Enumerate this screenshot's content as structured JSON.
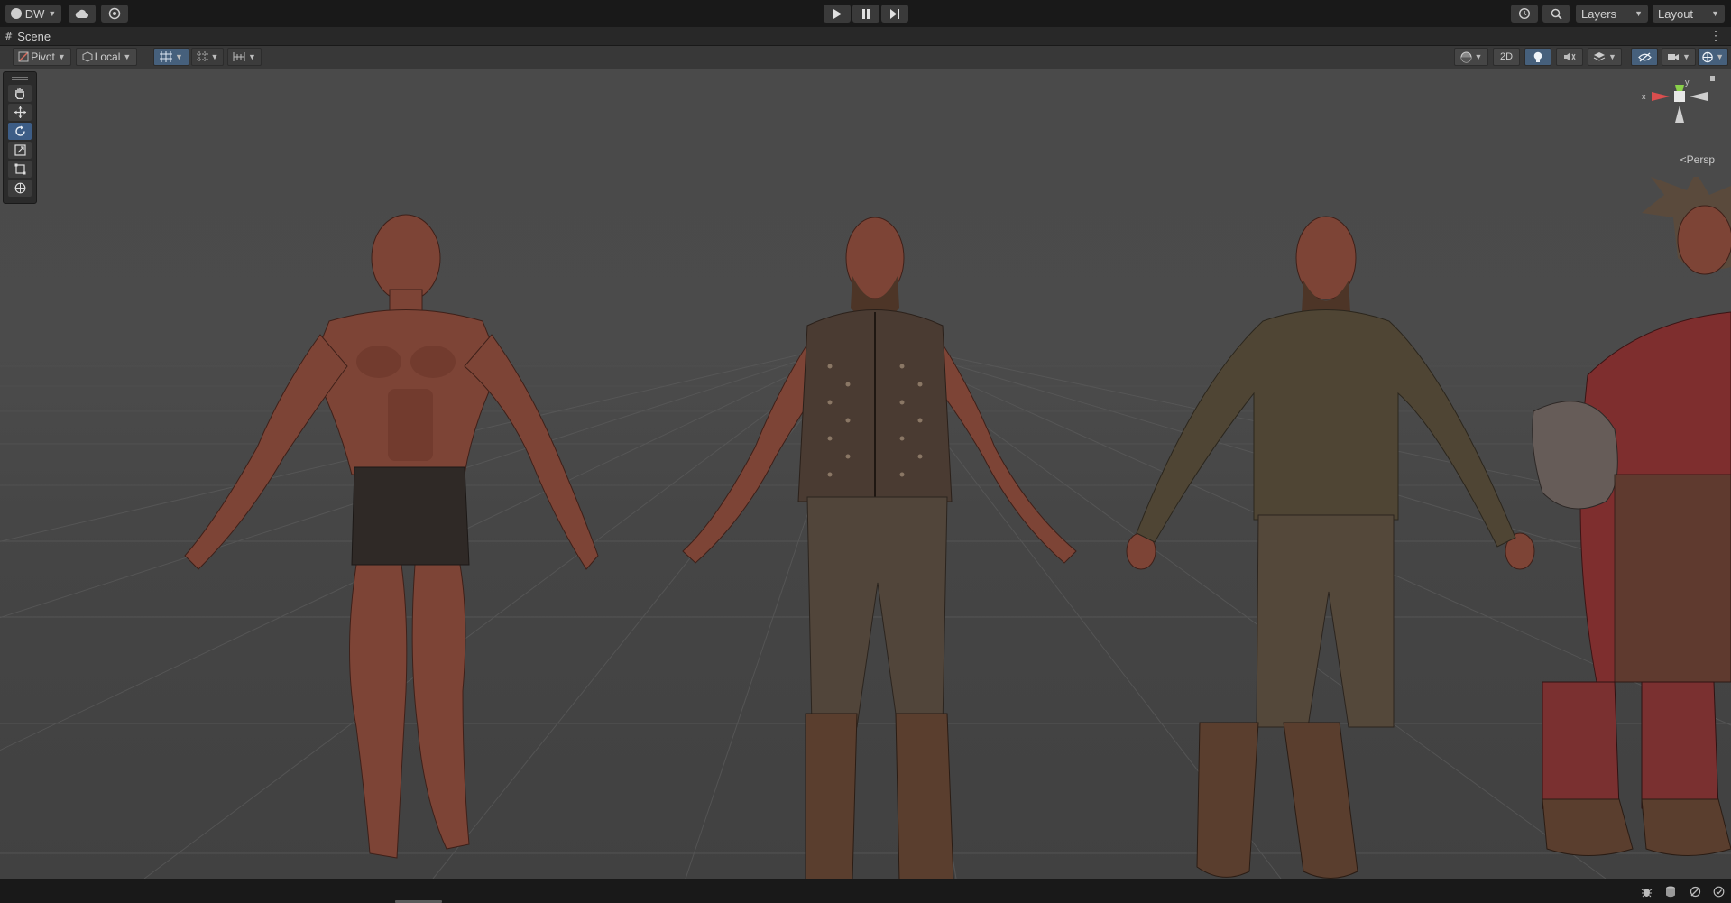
{
  "toolbar": {
    "account_label": "DW",
    "layers_label": "Layers",
    "layout_label": "Layout",
    "icons": [
      "account-icon",
      "cloud-icon",
      "collab-icon",
      "play-icon",
      "pause-icon",
      "step-icon",
      "history-icon",
      "search-icon"
    ]
  },
  "tab": {
    "title": "Scene",
    "menu_glyph": "⋮"
  },
  "scene_toolbar": {
    "pivot_label": "Pivot",
    "local_label": "Local",
    "two_d_label": "2D"
  },
  "tools": [
    "hand-tool",
    "move-tool",
    "rotate-tool",
    "scale-tool",
    "rect-tool",
    "transform-tool"
  ],
  "active_tool": "rotate-tool",
  "gizmo": {
    "x_label": "x",
    "y_label": "y",
    "persp_label": "Persp",
    "x_color": "#db4e4e",
    "y_color": "#8ad14a",
    "z_color": "#cfcfcf"
  },
  "scene": {
    "figures": [
      {
        "name": "figure-bare-muscular",
        "skin": "#8a4a3c",
        "underwear": "#2f2926"
      },
      {
        "name": "figure-studded-vest",
        "skin": "#8a4a3c",
        "vest": "#4a3b32",
        "pants": "#51453a",
        "boots": "#5a3e2e"
      },
      {
        "name": "figure-brown-tunic",
        "skin": "#8a4a3c",
        "tunic": "#4f4534",
        "pants": "#54483a",
        "boots": "#5a3e2e"
      },
      {
        "name": "figure-armored-partial",
        "skin": "#8a4a3c",
        "armor": "#7e2e2e"
      }
    ]
  },
  "colors": {
    "accent": "#3d5d86",
    "toolbar_bg": "#191919",
    "viewport_bg": "#4a4a4a"
  }
}
